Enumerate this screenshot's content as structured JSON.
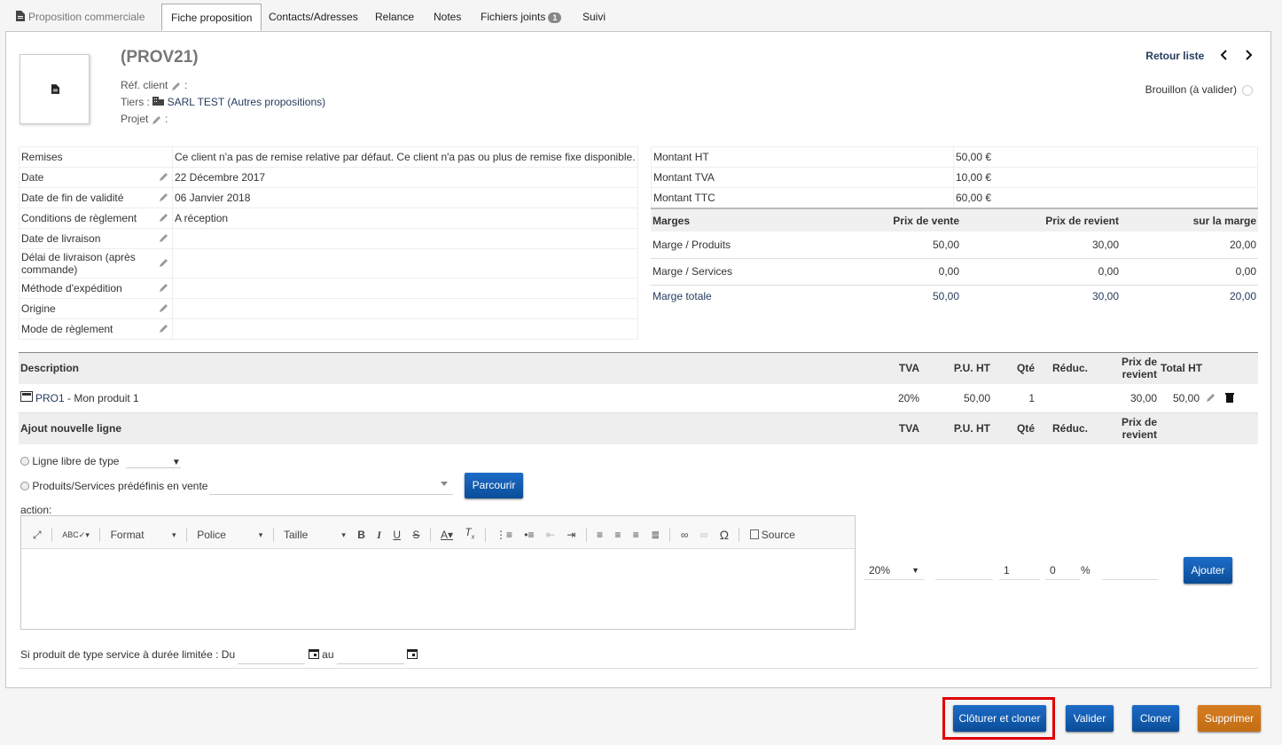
{
  "tabs": [
    {
      "label": "Proposition commerciale"
    },
    {
      "label": "Fiche proposition"
    },
    {
      "label": "Contacts/Adresses"
    },
    {
      "label": "Relance"
    },
    {
      "label": "Notes"
    },
    {
      "label": "Fichiers joints",
      "badge": "1"
    },
    {
      "label": "Suivi"
    }
  ],
  "header": {
    "ref": "(PROV21)",
    "ref_client_label": "Réf. client",
    "tiers_label": "Tiers :",
    "tiers_name": "SARL TEST",
    "tiers_other": "(Autres propositions)",
    "projet_label": "Projet",
    "colon": ":",
    "back_list": "Retour liste",
    "status": "Brouillon (à valider)"
  },
  "fields": [
    {
      "label": "Remises",
      "value": "Ce client n'a pas de remise relative par défaut. Ce client n'a pas ou plus de remise fixe disponible."
    },
    {
      "label": "Date",
      "value": "22 Décembre 2017"
    },
    {
      "label": "Date de fin de validité",
      "value": "06 Janvier 2018"
    },
    {
      "label": "Conditions de règlement",
      "value": "A réception"
    },
    {
      "label": "Date de livraison",
      "value": ""
    },
    {
      "label": "Délai de livraison (après commande)",
      "value": ""
    },
    {
      "label": "Méthode d'expédition",
      "value": ""
    },
    {
      "label": "Origine",
      "value": ""
    },
    {
      "label": "Mode de règlement",
      "value": ""
    }
  ],
  "amounts": [
    {
      "label": "Montant HT",
      "value": "50,00 €"
    },
    {
      "label": "Montant TVA",
      "value": "10,00 €"
    },
    {
      "label": "Montant TTC",
      "value": "60,00 €"
    }
  ],
  "margins": {
    "headers": [
      "Marges",
      "Prix de vente",
      "Prix de revient",
      "sur la marge"
    ],
    "rows": [
      {
        "label": "Marge / Produits",
        "sale": "50,00",
        "cost": "30,00",
        "margin": "20,00"
      },
      {
        "label": "Marge / Services",
        "sale": "0,00",
        "cost": "0,00",
        "margin": "0,00"
      }
    ],
    "total": {
      "label": "Marge totale",
      "sale": "50,00",
      "cost": "30,00",
      "margin": "20,00"
    }
  },
  "lines": {
    "headers": {
      "description": "Description",
      "tva": "TVA",
      "pu": "P.U. HT",
      "qty": "Qté",
      "reduc": "Réduc.",
      "prix_revient": "Prix de revient",
      "total": "Total HT"
    },
    "items": [
      {
        "ref": "PRO1",
        "label": " - Mon produit 1",
        "tva": "20%",
        "pu": "50,00",
        "qty": "1",
        "reduc": "",
        "prix_revient": "30,00",
        "total": "50,00"
      }
    ]
  },
  "add_line": {
    "title": "Ajout nouvelle ligne",
    "free_line_label": "Ligne libre de type",
    "predefined_label": "Produits/Services prédéfinis en vente",
    "browse_button": "Parcourir",
    "action_label": "action:",
    "editor_toolbar": {
      "format": "Format",
      "police": "Police",
      "taille": "Taille",
      "source": "Source"
    },
    "tva_value": "20%",
    "pu_value": "",
    "qty_value": "1",
    "reduc_value": "0",
    "percent": "%",
    "add_button": "Ajouter",
    "service_dates_label": "Si produit de type service à durée limitée : Du",
    "au_label": "au"
  },
  "actions": {
    "close_clone": "Clôturer et cloner",
    "validate": "Valider",
    "clone": "Cloner",
    "delete": "Supprimer"
  },
  "colors": {
    "accent": "#0a4d98",
    "link": "#263c5c",
    "delete": "#c26d14",
    "highlight": "#e00000"
  }
}
